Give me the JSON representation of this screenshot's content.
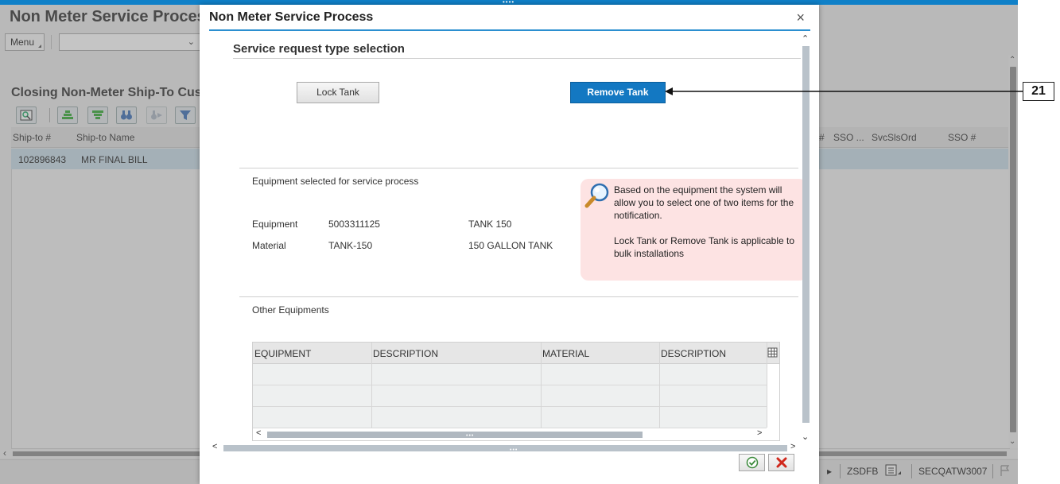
{
  "background": {
    "page_title": "Non Meter Service Process",
    "menu_label": "Menu",
    "dropdown_value": "",
    "section_title": "Closing Non-Meter Ship-To Customers",
    "grid_columns_left": [
      "Ship-to #",
      "Ship-to Name"
    ],
    "grid_columns_right": [
      "#",
      "SSO ...",
      "SvcSlsOrd",
      "SSO #"
    ],
    "rows": [
      {
        "ship_to": "102896843",
        "ship_to_name": "MR FINAL BILL"
      }
    ],
    "status_bar": {
      "system": "ZSDFB",
      "server": "SECQATW3007"
    }
  },
  "dialog": {
    "title": "Non Meter Service Process",
    "close_symbol": "×",
    "section_title": "Service request type selection",
    "lock_button": "Lock Tank",
    "remove_button": "Remove Tank",
    "equipment_section_title": "Equipment selected for service process",
    "equipment": {
      "label": "Equipment",
      "number": "5003311125",
      "description": "TANK 150"
    },
    "material": {
      "label": "Material",
      "number": "TANK-150",
      "description": "150 GALLON TANK"
    },
    "note": {
      "line1": "Based on the equipment the system will allow you to select one of two items for the notification.",
      "line2": "Lock Tank or Remove Tank is applicable to bulk installations"
    },
    "other_equipments_title": "Other Equipments",
    "other_table": {
      "columns": [
        "EQUIPMENT",
        "DESCRIPTION",
        "MATERIAL",
        "DESCRIPTION"
      ],
      "rows": []
    }
  },
  "callout": {
    "number": "21"
  },
  "colors": {
    "accent_blue": "#1378c2",
    "note_background": "#fde3e3",
    "selected_row": "#c9dce8"
  }
}
